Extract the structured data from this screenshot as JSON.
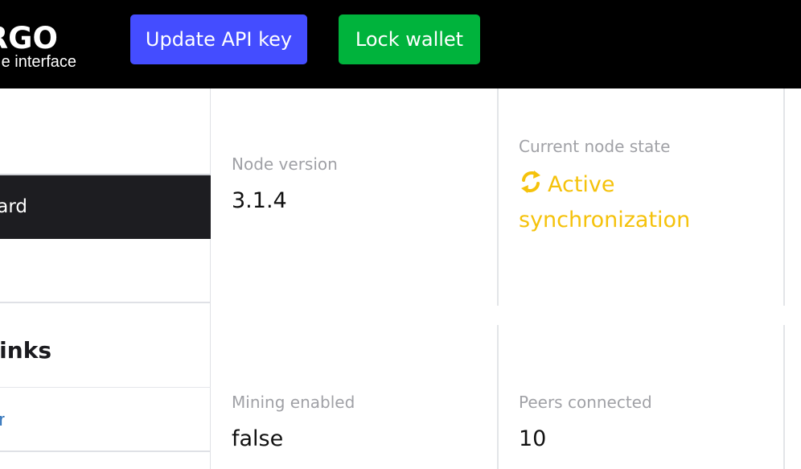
{
  "header": {
    "logo_title": "RGO",
    "logo_subtitle": "e interface",
    "update_api_key_label": "Update API key",
    "lock_wallet_label": "Lock wallet",
    "colors": {
      "update_api_key": "#444dff",
      "lock_wallet": "#00b33c",
      "background": "#000000"
    }
  },
  "sidebar": {
    "active_item_label": "ard",
    "links_heading": "links",
    "link_item_label": "r"
  },
  "cards": {
    "node_version": {
      "label": "Node version",
      "value": "3.1.4"
    },
    "node_state": {
      "label": "Current node state",
      "value": "Active synchronization",
      "icon": "sync-icon",
      "color": "#f5c20b"
    },
    "mining": {
      "label": "Mining enabled",
      "value": "false"
    },
    "peers": {
      "label": "Peers connected",
      "value": "10"
    }
  }
}
